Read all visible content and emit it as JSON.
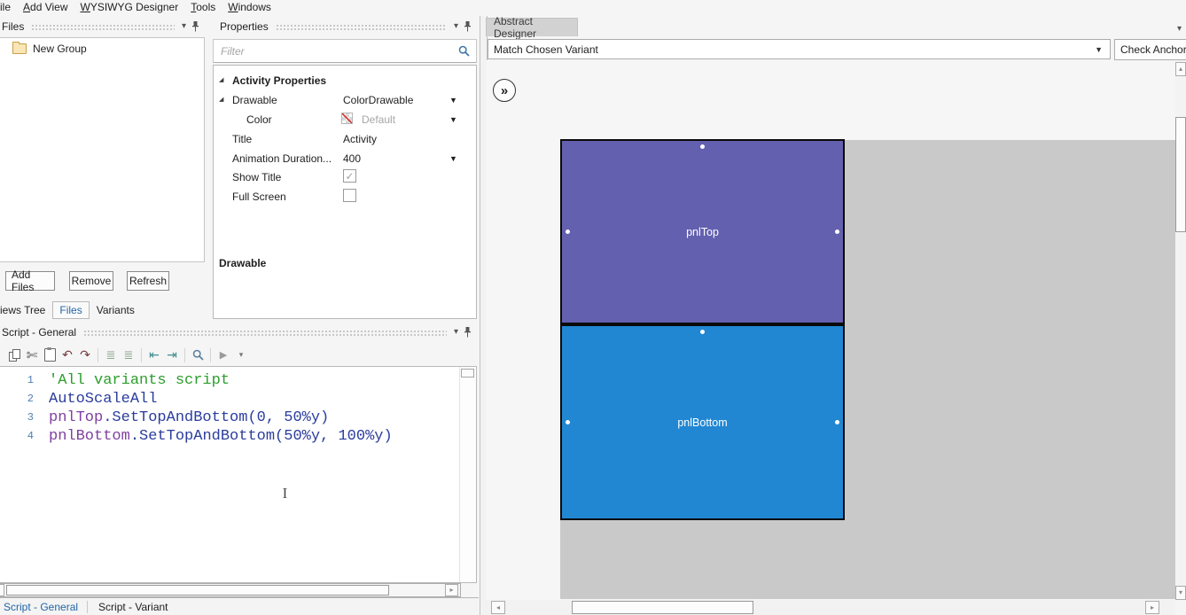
{
  "menu": {
    "items": [
      {
        "label": "ile"
      },
      {
        "key": "A",
        "rest": "dd View"
      },
      {
        "key": "W",
        "rest": "YSIWYG Designer"
      },
      {
        "key": "T",
        "rest": "ools"
      },
      {
        "key": "W",
        "rest": "indows"
      }
    ]
  },
  "files_panel": {
    "title": "Files",
    "tree_items": [
      {
        "label": "New Group",
        "icon": "folder-icon"
      }
    ],
    "buttons": {
      "add": "Add Files",
      "remove": "Remove",
      "refresh": "Refresh"
    },
    "tabs": {
      "views_tree": "iews Tree",
      "files": "Files",
      "variants": "Variants"
    }
  },
  "properties_panel": {
    "title": "Properties",
    "filter_placeholder": "Filter",
    "section_title": "Activity Properties",
    "rows": {
      "drawable": {
        "label": "Drawable",
        "value": "ColorDrawable"
      },
      "color": {
        "label": "Color",
        "value": "Default",
        "swatch": "transparent-color-swatch"
      },
      "title": {
        "label": "Title",
        "value": "Activity"
      },
      "animation": {
        "label": "Animation Duration...",
        "value": "400"
      },
      "show_title": {
        "label": "Show Title",
        "checked": true
      },
      "full_screen": {
        "label": "Full Screen",
        "checked": false
      }
    },
    "footer_section": "Drawable"
  },
  "script_panel": {
    "title": "Script - General",
    "toolbar_icons": [
      "copy",
      "cut",
      "paste",
      "undo",
      "redo",
      "comment",
      "uncomment",
      "outdent",
      "indent",
      "find",
      "run",
      "more-options"
    ],
    "code_lines": [
      {
        "num": "1",
        "segments": [
          {
            "text": "'All variants script",
            "type": "comment"
          }
        ]
      },
      {
        "num": "2",
        "segments": [
          {
            "text": "AutoScaleAll",
            "type": "code"
          }
        ]
      },
      {
        "num": "3",
        "segments": [
          {
            "text": "pnlTop",
            "type": "view"
          },
          {
            "text": ".SetTopAndBottom(0, 50%y)",
            "type": "code"
          }
        ]
      },
      {
        "num": "4",
        "segments": [
          {
            "text": "pnlBottom",
            "type": "view"
          },
          {
            "text": ".SetTopAndBottom(50%y, 100%y)",
            "type": "code"
          }
        ]
      }
    ],
    "tabs": {
      "general": "Script - General",
      "variant": "Script - Variant"
    }
  },
  "designer": {
    "tab": "Abstract Designer",
    "variant_selector_value": "Match Chosen Variant",
    "check_anchors_label": "Check Anchors",
    "expand_glyph": "»",
    "activity_color": "#C9C9C9",
    "views": {
      "top": {
        "label": "pnlTop",
        "color": "#6360AF"
      },
      "bottom": {
        "label": "pnlBottom",
        "color": "#2187D3"
      }
    }
  }
}
